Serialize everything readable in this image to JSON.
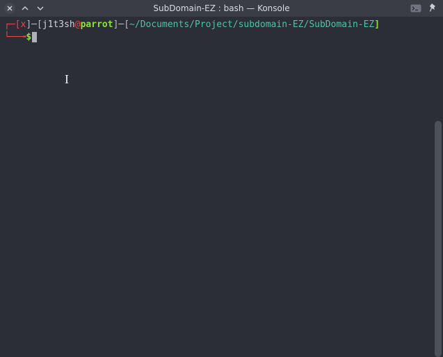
{
  "window": {
    "title": "SubDomain-EZ : bash — Konsole"
  },
  "prompt": {
    "corner_tl": "┌─",
    "bracket_open": "[",
    "status_x": "x",
    "bracket_close": "]",
    "dash": "─",
    "user": "j1t3sh",
    "at": "@",
    "host": "parrot",
    "path": "~/Documents/Project/subdomain-EZ/SubDomain-EZ",
    "corner_bl": "└──╼",
    "dollar": "$"
  }
}
